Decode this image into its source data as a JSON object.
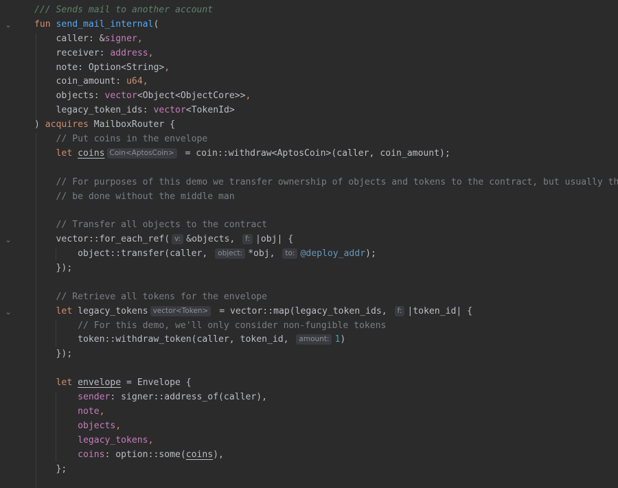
{
  "doc_comment": "/// Sends mail to another account",
  "fn_signature": {
    "keyword": "fun",
    "name": "send_mail_internal",
    "params": [
      {
        "name": "caller",
        "type_prefix": "&",
        "type": "signer"
      },
      {
        "name": "receiver",
        "type": "address"
      },
      {
        "name": "note",
        "type": "Option<String>"
      },
      {
        "name": "coin_amount",
        "type": "u64"
      },
      {
        "name": "objects",
        "generic": "vector",
        "type": "<Object<ObjectCore>>"
      },
      {
        "name": "legacy_token_ids",
        "generic": "vector",
        "type": "<TokenId>"
      }
    ],
    "acquires_keyword": "acquires",
    "acquires": "MailboxRouter"
  },
  "body": {
    "comment_coins": "// Put coins in the envelope",
    "let_kw": "let",
    "coins_var": "coins",
    "coins_hint": "Coin<AptosCoin>",
    "coins_rhs": " = coin::withdraw<AptosCoin>(caller, coin_amount);",
    "comment_purpose_1": "// For purposes of this demo we transfer ownership of objects and tokens to the contract, but usually this can",
    "comment_purpose_2": "// be done without the middle man",
    "comment_transfer": "// Transfer all objects to the contract",
    "for_each_call": "vector::for_each_ref(",
    "hint_v": "v:",
    "for_each_arg": "&objects,",
    "hint_f": "f:",
    "for_each_lambda": "|obj| {",
    "transfer_call": "object::transfer(caller,",
    "hint_object": "object:",
    "transfer_arg": "*obj,",
    "hint_to": "to:",
    "deploy_addr": "@deploy_addr",
    "transfer_end": ");",
    "close_lambda": "});",
    "comment_retrieve": "// Retrieve all tokens for the envelope",
    "legacy_var": "legacy_tokens",
    "legacy_hint": "vector<Token>",
    "map_call": " = vector::map(legacy_token_ids,",
    "map_lambda": "|token_id| {",
    "comment_nft": "// For this demo, we'll only consider non-fungible tokens",
    "withdraw_call": "token::withdraw_token(caller, token_id,",
    "hint_amount": "amount:",
    "amount_value": "1",
    "envelope_var": "envelope",
    "envelope_rhs": " = Envelope {",
    "field_sender": "sender",
    "sender_rhs": ": signer::address_of(caller),",
    "field_note": "note",
    "field_objects": "objects",
    "field_legacy": "legacy_tokens",
    "field_coins": "coins",
    "coins_rhs2_a": ": option::some(",
    "coins_rhs2_var": "coins",
    "coins_rhs2_b": "),",
    "close_struct": "};"
  },
  "colors": {
    "background": "#2b2b2b",
    "keyword": "#cf8e6d",
    "function": "#56a8f5",
    "comment": "#7a7e85",
    "doc_comment": "#5f826b",
    "field": "#c77dbb",
    "number": "#2aacb8",
    "text": "#bcbec4"
  }
}
